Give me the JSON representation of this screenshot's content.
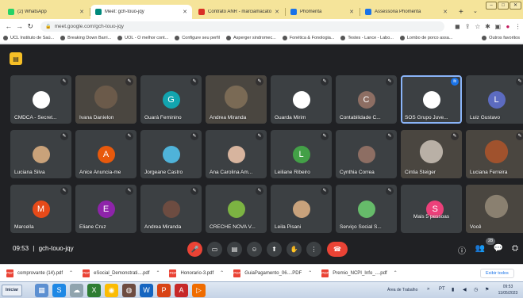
{
  "browser": {
    "tabs": [
      {
        "title": "(2) WhatsApp",
        "favicon_color": "#25d366",
        "active": false
      },
      {
        "title": "Meet: gch-touo-jqy",
        "favicon_color": "#00897b",
        "active": true
      },
      {
        "title": "Contrato ANR - marciamacato",
        "favicon_color": "#d93025",
        "active": false
      },
      {
        "title": "Phomenta",
        "favicon_color": "#1a73e8",
        "active": false
      },
      {
        "title": "Assessoria Phomenta",
        "favicon_color": "#1a73e8",
        "active": false
      }
    ],
    "new_tab_label": "+",
    "url": "meet.google.com/gch-touo-jqy",
    "bookmarks": [
      "UCL Instituto de Saú...",
      "Breaking Down Barri...",
      "UOL - O melhor cont...",
      "Configure seu perfil",
      "Asperger sindromec...",
      "Fonética & Fonologia...",
      "Testes - Lance - Labo...",
      "Lombo de porco assa...",
      "Outros favoritos"
    ]
  },
  "meet": {
    "meeting_code": "gch-touo-jqy",
    "time": "09:53",
    "time_separator": "|",
    "people_count": "28",
    "tiles": [
      {
        "name": "CMDCA - Secret...",
        "kind": "logo",
        "initial": "",
        "color": "#ffffff",
        "mic": "muted"
      },
      {
        "name": "Ivana Danielon",
        "kind": "video",
        "initial": "",
        "color": "#6b5a4a",
        "mic": "muted"
      },
      {
        "name": "Guará Feminino",
        "kind": "initial",
        "initial": "G",
        "color": "#12a4af",
        "mic": "muted"
      },
      {
        "name": "Andrea Miranda",
        "kind": "video",
        "initial": "",
        "color": "#7a6a55",
        "mic": "muted"
      },
      {
        "name": "Guarda Mirim",
        "kind": "logo",
        "initial": "",
        "color": "#ffffff",
        "mic": "muted"
      },
      {
        "name": "Contabilidade C...",
        "kind": "initial",
        "initial": "C",
        "color": "#8d6e63",
        "mic": "muted"
      },
      {
        "name": "SOS Grupo Juve...",
        "kind": "logo",
        "initial": "",
        "color": "#ffffff",
        "mic": "active"
      },
      {
        "name": "Luiz Gustavo",
        "kind": "initial",
        "initial": "L",
        "color": "#5c6bc0",
        "mic": "muted"
      },
      {
        "name": "Luciana Silva",
        "kind": "photo",
        "initial": "",
        "color": "#c9a27a",
        "mic": "muted"
      },
      {
        "name": "Anice Anuncia-me",
        "kind": "initial",
        "initial": "A",
        "color": "#e8590c",
        "mic": "muted"
      },
      {
        "name": "Jorgeane Castro",
        "kind": "photo",
        "initial": "",
        "color": "#4fb3d9",
        "mic": "muted"
      },
      {
        "name": "Ana Carolina Am...",
        "kind": "photo",
        "initial": "",
        "color": "#d7b49e",
        "mic": "muted"
      },
      {
        "name": "Leiliane Ribeiro",
        "kind": "initial",
        "initial": "L",
        "color": "#43a047",
        "mic": "muted"
      },
      {
        "name": "Cynthia Correa",
        "kind": "photo",
        "initial": "",
        "color": "#8d6e63",
        "mic": "muted"
      },
      {
        "name": "Cintia Steiger",
        "kind": "video",
        "initial": "",
        "color": "#b9b0a6",
        "mic": "muted"
      },
      {
        "name": "Luciana Ferreira",
        "kind": "video",
        "initial": "",
        "color": "#a0522d",
        "mic": "muted"
      },
      {
        "name": "Marcella",
        "kind": "initial",
        "initial": "M",
        "color": "#e64a19",
        "mic": "muted"
      },
      {
        "name": "Eliane Cruz",
        "kind": "initial",
        "initial": "E",
        "color": "#8e24aa",
        "mic": "muted"
      },
      {
        "name": "Andrea Miranda",
        "kind": "photo",
        "initial": "",
        "color": "#6d4c41",
        "mic": "muted"
      },
      {
        "name": "CRECHE NOVA V...",
        "kind": "photo",
        "initial": "",
        "color": "#7cb342",
        "mic": "muted"
      },
      {
        "name": "Leila Pisani",
        "kind": "photo",
        "initial": "",
        "color": "#c8a27c",
        "mic": "muted"
      },
      {
        "name": "Serviço Social S...",
        "kind": "photo",
        "initial": "",
        "color": "#66bb6a",
        "mic": "muted"
      },
      {
        "name": "Mais 5 pessoas",
        "kind": "more",
        "initial": "S",
        "color": "#ec407a",
        "mic": "none"
      },
      {
        "name": "Você",
        "kind": "video",
        "initial": "",
        "color": "#8a8070",
        "mic": "none"
      }
    ],
    "controls": {
      "mic_icon": "mic-off-icon",
      "camera_icon": "camera-icon",
      "captions_icon": "captions-icon",
      "emoji_icon": "emoji-icon",
      "present_icon": "present-icon",
      "hand_icon": "raise-hand-icon",
      "more_icon": "more-options-icon",
      "end_icon": "end-call-icon"
    }
  },
  "downloads": {
    "items": [
      "comprovante (14).pdf",
      "eSocial_Demonstrati....pdf",
      "Honorario-3.pdf",
      "GuiaPagamento_06....PDF",
      "Premio_NCPI_Info_....pdf"
    ],
    "show_all": "Exibir todos"
  },
  "taskbar": {
    "start_label": "Iniciar",
    "tray_label": "Área de Trabalho",
    "language": "PT",
    "clock_time": "09:53",
    "clock_date": "11/05/2023"
  }
}
